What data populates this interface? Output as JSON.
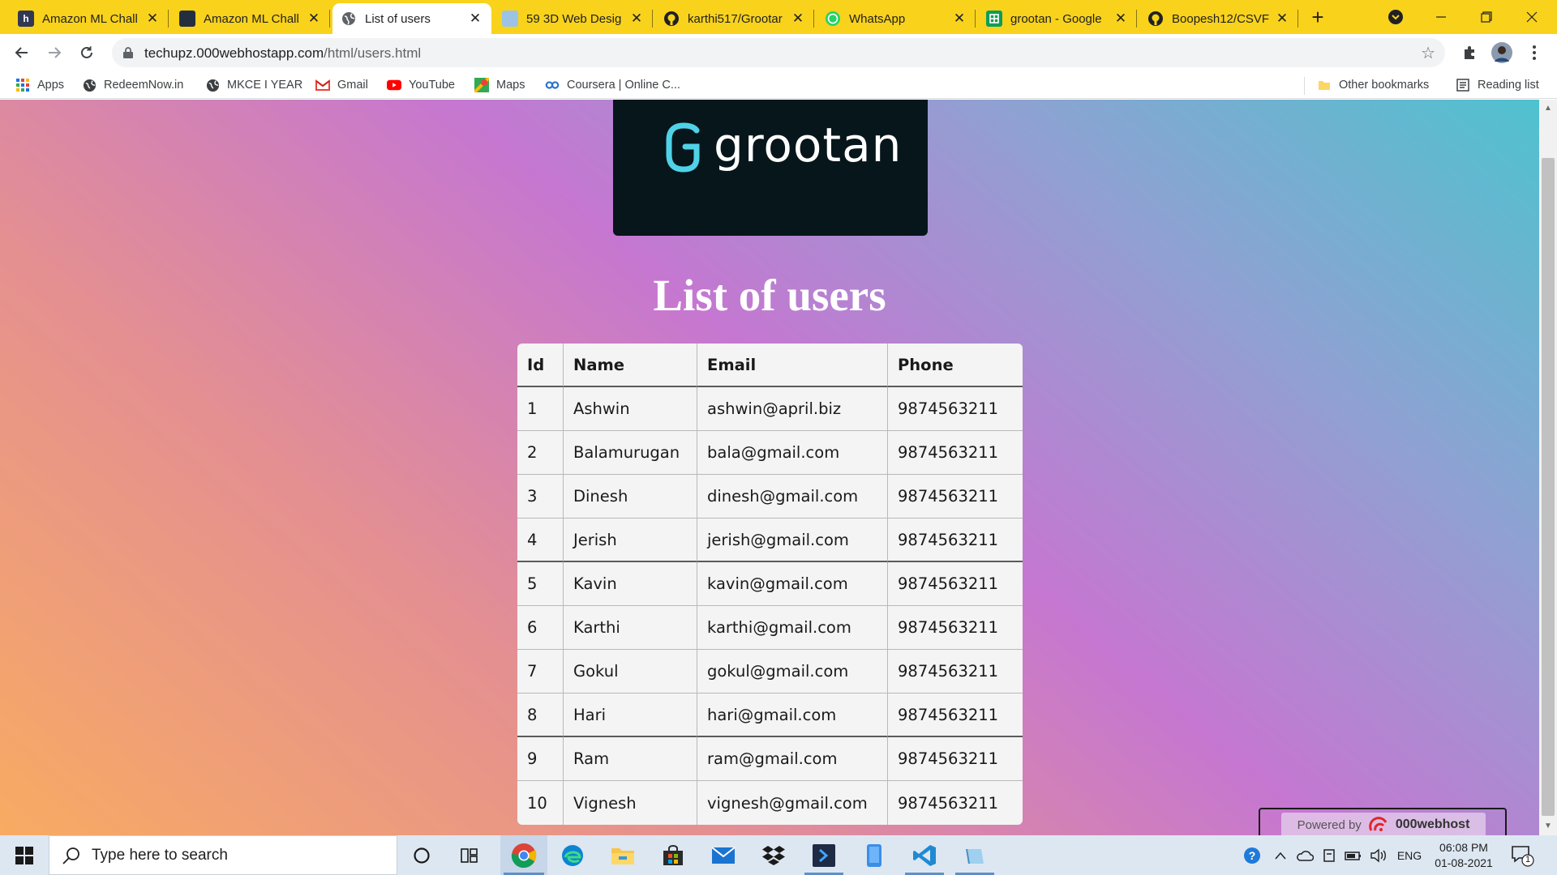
{
  "browser": {
    "tabs": [
      {
        "label": "Amazon ML Chall",
        "icon": "hackerearth-icon",
        "active": false
      },
      {
        "label": "Amazon ML Chall",
        "icon": "amazon-icon",
        "active": false
      },
      {
        "label": "List of users",
        "icon": "globe-icon",
        "active": true
      },
      {
        "label": "59 3D Web Desig",
        "icon": "image-icon",
        "active": false
      },
      {
        "label": "karthi517/Grootar",
        "icon": "github-icon",
        "active": false
      },
      {
        "label": "WhatsApp",
        "icon": "whatsapp-icon",
        "active": false
      },
      {
        "label": "grootan - Google",
        "icon": "google-sheets-icon",
        "active": false
      },
      {
        "label": "Boopesh12/CSVF",
        "icon": "github-icon",
        "active": false
      }
    ],
    "tab_close_glyph": "✕",
    "new_tab_glyph": "+",
    "url_host": "techupz.000webhostapp.com",
    "url_path": "/html/users.html",
    "tabstrip_color": "#f9d21b",
    "bookmarks": [
      {
        "label": "Apps",
        "icon": "apps-grid-icon"
      },
      {
        "label": "RedeemNow.in",
        "icon": "globe-icon"
      },
      {
        "label": "MKCE I YEAR",
        "icon": "globe-icon"
      },
      {
        "label": "Gmail",
        "icon": "gmail-icon"
      },
      {
        "label": "YouTube",
        "icon": "youtube-icon"
      },
      {
        "label": "Maps",
        "icon": "maps-icon"
      },
      {
        "label": "Coursera | Online C...",
        "icon": "coursera-icon"
      }
    ],
    "other_bookmarks": "Other bookmarks",
    "reading_list": "Reading list"
  },
  "page": {
    "logo_text": "grootan",
    "title": "List of users",
    "columns": [
      "Id",
      "Name",
      "Email",
      "Phone"
    ],
    "rows": [
      [
        "1",
        "Ashwin",
        "ashwin@april.biz",
        "9874563211"
      ],
      [
        "2",
        "Balamurugan",
        "bala@gmail.com",
        "9874563211"
      ],
      [
        "3",
        "Dinesh",
        "dinesh@gmail.com",
        "9874563211"
      ],
      [
        "4",
        "Jerish",
        "jerish@gmail.com",
        "9874563211"
      ],
      [
        "5",
        "Kavin",
        "kavin@gmail.com",
        "9874563211"
      ],
      [
        "6",
        "Karthi",
        "karthi@gmail.com",
        "9874563211"
      ],
      [
        "7",
        "Gokul",
        "gokul@gmail.com",
        "9874563211"
      ],
      [
        "8",
        "Hari",
        "hari@gmail.com",
        "9874563211"
      ],
      [
        "9",
        "Ram",
        "ram@gmail.com",
        "9874563211"
      ],
      [
        "10",
        "Vignesh",
        "vignesh@gmail.com",
        "9874563211"
      ]
    ],
    "powered_by": "Powered by",
    "host_brand": "000webhost",
    "logo_accent": "#4fd2e8"
  },
  "taskbar": {
    "search_placeholder": "Type here to search",
    "apps": [
      "cortana-icon",
      "task-view-icon",
      "chrome-icon",
      "edge-icon",
      "file-explorer-icon",
      "store-icon",
      "mail-icon",
      "dropbox-icon",
      "powershell-icon",
      "phone-icon",
      "vscode-icon",
      "notepad-icon"
    ],
    "language": "ENG",
    "time": "06:08 PM",
    "date": "01-08-2021",
    "notification_count": "1"
  }
}
